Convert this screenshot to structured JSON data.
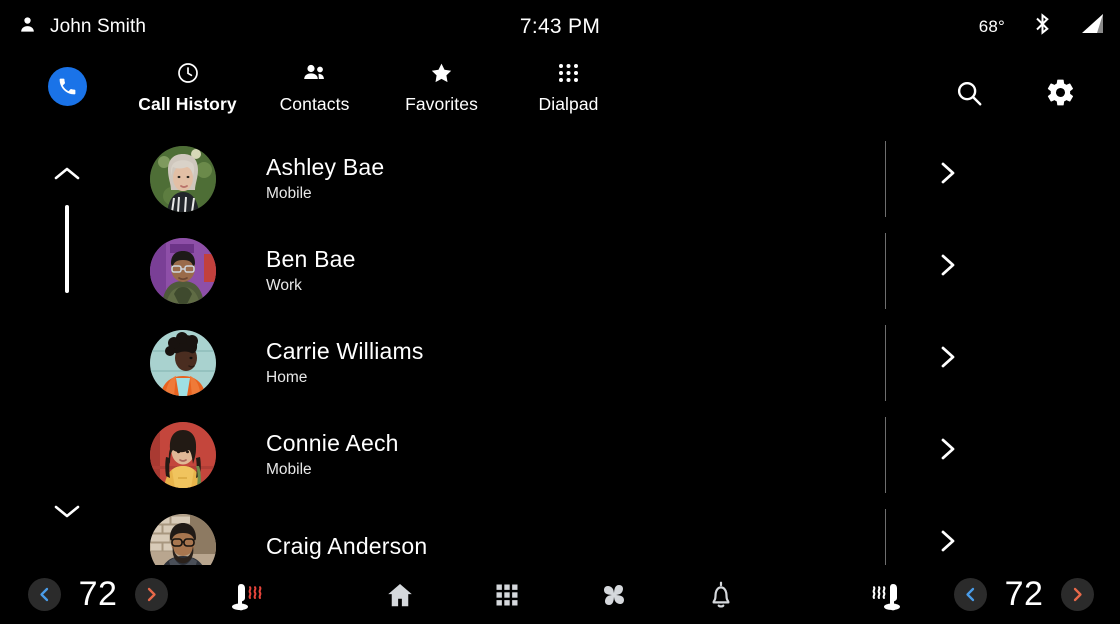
{
  "status_bar": {
    "user_name": "John Smith",
    "user_icon": "person-icon",
    "clock": "7:43 PM",
    "outside_temp": "68°",
    "bluetooth_icon": "bluetooth-icon",
    "signal_icon": "signal-bars-icon"
  },
  "app_bar": {
    "app_icon": "phone-icon",
    "accent_color": "#1A73E8",
    "tabs": [
      {
        "label": "Call History",
        "icon": "clock-icon",
        "active": true
      },
      {
        "label": "Contacts",
        "icon": "people-icon",
        "active": false
      },
      {
        "label": "Favorites",
        "icon": "star-icon",
        "active": false
      },
      {
        "label": "Dialpad",
        "icon": "dialpad-icon",
        "active": false
      }
    ],
    "search_icon": "search-icon",
    "settings_icon": "gear-icon"
  },
  "list": {
    "scroll_up_icon": "chevron-up-icon",
    "scroll_down_icon": "chevron-down-icon",
    "row_chevron_icon": "chevron-right-icon",
    "contacts": [
      {
        "name": "Ashley Bae",
        "label": "Mobile",
        "avatar_bg": "#5a7a42"
      },
      {
        "name": "Ben Bae",
        "label": "Work",
        "avatar_bg": "#8e4fa8"
      },
      {
        "name": "Carrie Williams",
        "label": "Home",
        "avatar_bg": "#a8d4d2"
      },
      {
        "name": "Connie Aech",
        "label": "Mobile",
        "avatar_bg": "#c1483f"
      },
      {
        "name": "Craig Anderson",
        "label": "",
        "avatar_bg": "#8c7a68"
      }
    ]
  },
  "footer": {
    "left_climate": {
      "decrease_icon": "chevron-left-icon",
      "temperature": "72",
      "increase_icon": "chevron-right-icon",
      "decrease_color": "#4a9ce8",
      "increase_color": "#e8694a"
    },
    "right_climate": {
      "decrease_icon": "chevron-left-icon",
      "temperature": "72",
      "increase_icon": "chevron-right-icon",
      "decrease_color": "#4a9ce8",
      "increase_color": "#e8694a"
    },
    "left_seat_icon": "heated-seat-icon",
    "right_seat_icon": "ventilated-seat-icon",
    "nav_icons": [
      {
        "icon": "home-icon"
      },
      {
        "icon": "apps-grid-icon"
      },
      {
        "icon": "fan-climate-icon"
      },
      {
        "icon": "notification-bell-icon"
      }
    ]
  }
}
